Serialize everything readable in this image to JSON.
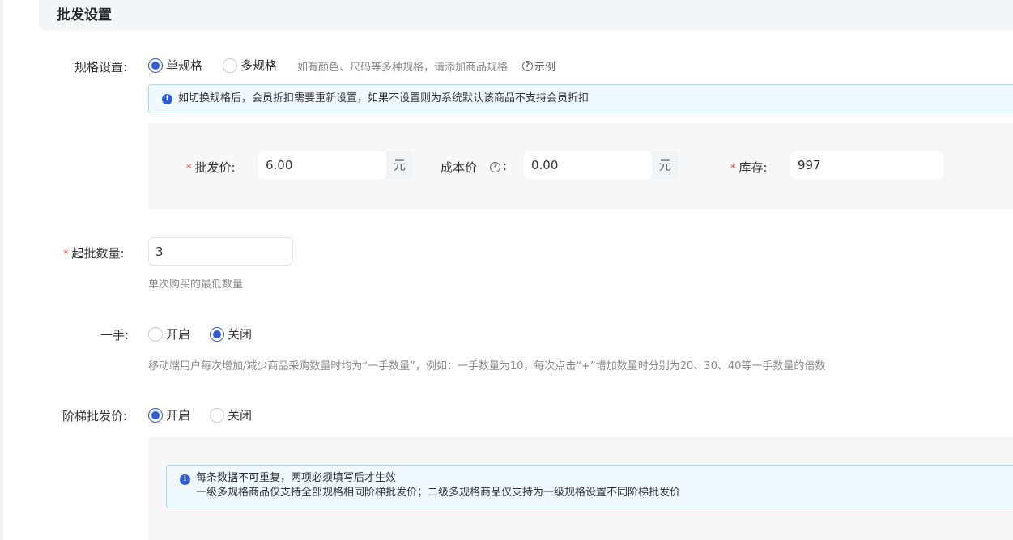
{
  "section_title": "批发设置",
  "spec": {
    "label": "规格设置:",
    "options": [
      "单规格",
      "多规格"
    ],
    "selected": "单规格",
    "hint": "如有颜色、尺码等多种规格，请添加商品规格",
    "example_label": "示例",
    "alert": "如切换规格后，会员折扣需要重新设置，如果不设置则为系统默认该商品不支持会员折扣"
  },
  "price_row": {
    "wholesale_label": "批发价:",
    "wholesale_value": "6.00",
    "wholesale_suffix": "元",
    "cost_label": "成本价",
    "cost_colon": ":",
    "cost_value": "0.00",
    "cost_suffix": "元",
    "stock_label": "库存:",
    "stock_value": "997"
  },
  "min_qty": {
    "label": "起批数量:",
    "value": "3",
    "help": "单次购买的最低数量"
  },
  "lot": {
    "label": "一手:",
    "options": [
      "开启",
      "关闭"
    ],
    "selected": "关闭",
    "help": "移动端用户每次增加/减少商品采购数量时均为“一手数量”，例如：一手数量为10，每次点击“+”增加数量时分别为20、30、40等一手数量的倍数"
  },
  "tier": {
    "label": "阶梯批发价:",
    "options": [
      "开启",
      "关闭"
    ],
    "selected": "开启",
    "alert_line1": "每条数据不可重复，两项必须填写后才生效",
    "alert_line2": "一级多规格商品仅支持全部规格相同阶梯批发价；二级多规格商品仅支持为一级规格设置不同阶梯批发价"
  },
  "colors": {
    "primary": "#2e5bd8",
    "required": "#e5412d",
    "alert_bg": "#f0f9ff",
    "alert_border": "#a8dcf0"
  }
}
